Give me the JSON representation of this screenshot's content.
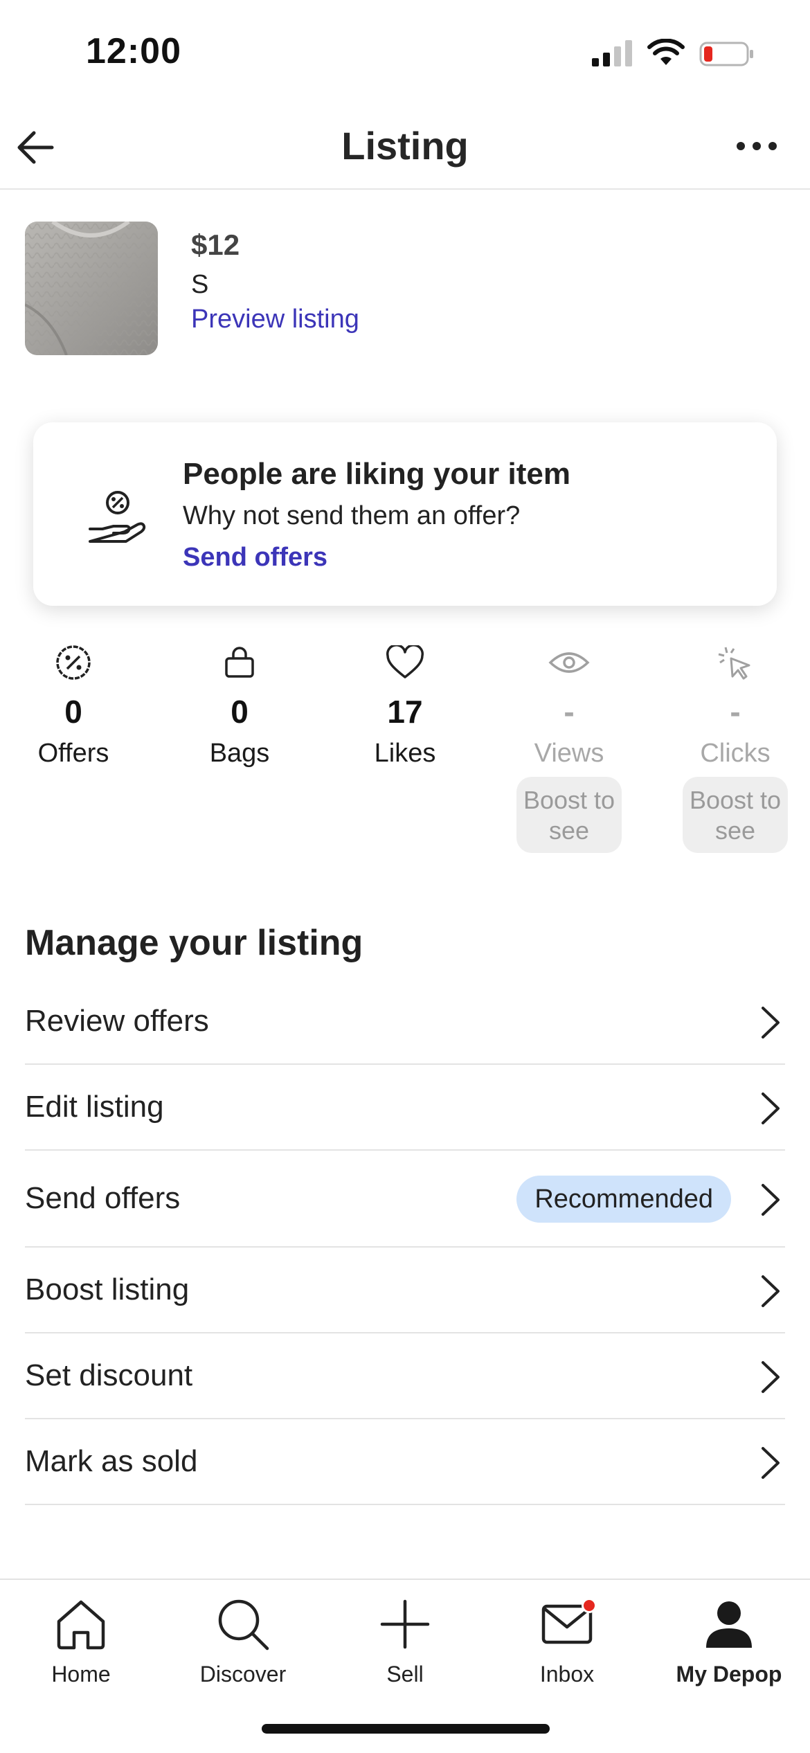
{
  "status": {
    "time": "12:00"
  },
  "nav": {
    "title": "Listing"
  },
  "item": {
    "price": "$12",
    "size": "S",
    "preview_link": "Preview listing"
  },
  "banner": {
    "title": "People are liking your item",
    "subtitle": "Why not send them an offer?",
    "link": "Send offers"
  },
  "stats": [
    {
      "icon": "percent-icon",
      "value": "0",
      "label": "Offers"
    },
    {
      "icon": "bag-icon",
      "value": "0",
      "label": "Bags"
    },
    {
      "icon": "heart-icon",
      "value": "17",
      "label": "Likes"
    },
    {
      "icon": "eye-icon",
      "value": "-",
      "label": "Views",
      "locked_text": "Boost to see"
    },
    {
      "icon": "cursor-click-icon",
      "value": "-",
      "label": "Clicks",
      "locked_text": "Boost to see"
    }
  ],
  "manage": {
    "title": "Manage your listing",
    "rows": [
      {
        "label": "Review offers"
      },
      {
        "label": "Edit listing"
      },
      {
        "label": "Send offers",
        "badge": "Recommended"
      },
      {
        "label": "Boost listing"
      },
      {
        "label": "Set discount"
      },
      {
        "label": "Mark as sold"
      }
    ]
  },
  "tabs": [
    {
      "icon": "home-icon",
      "label": "Home"
    },
    {
      "icon": "search-icon",
      "label": "Discover"
    },
    {
      "icon": "plus-icon",
      "label": "Sell"
    },
    {
      "icon": "mail-icon",
      "label": "Inbox"
    },
    {
      "icon": "user-icon",
      "label": "My Depop",
      "active": true
    }
  ],
  "colors": {
    "link": "#3c35b8",
    "badge_bg": "#cfe3fb",
    "notification": "#e5271f",
    "battery_low": "#e5271f"
  }
}
